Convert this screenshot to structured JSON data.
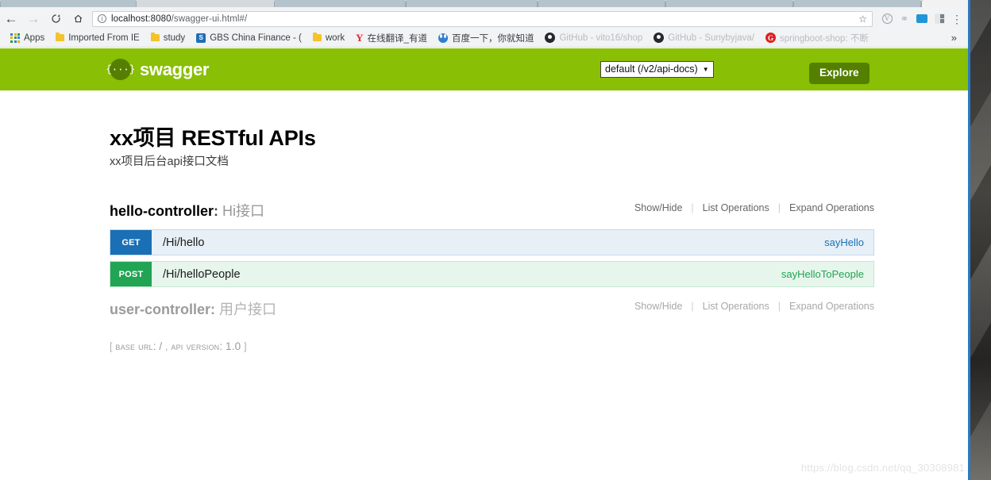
{
  "browser": {
    "nav": {
      "back_icon": "arrow-left-icon",
      "forward_icon": "arrow-right-icon",
      "reload_icon": "reload-icon",
      "home_icon": "home-icon"
    },
    "omnibox": {
      "info_glyph": "i",
      "url_host": "localhost:8080",
      "url_path": "/swagger-ui.html#/",
      "star_glyph": "☆"
    },
    "extensions": [
      {
        "name": "vimium-extension-icon",
        "glyph": "V"
      },
      {
        "name": "shield-extension-icon",
        "glyph": "⛉"
      },
      {
        "name": "chat-extension-icon",
        "glyph": ""
      },
      {
        "name": "window-split-extension-icon",
        "glyph": ""
      }
    ],
    "menu_glyph": "⋮",
    "bookmarks": [
      {
        "label": "Apps",
        "icon": "apps-grid-icon"
      },
      {
        "label": "Imported From IE",
        "icon": "folder-icon"
      },
      {
        "label": "study",
        "icon": "folder-icon"
      },
      {
        "label": "GBS China Finance - (",
        "icon": "sharepoint-icon"
      },
      {
        "label": "work",
        "icon": "folder-icon"
      },
      {
        "label": "在线翻译_有道",
        "icon": "youdao-icon"
      },
      {
        "label": "百度一下，你就知道",
        "icon": "baidu-icon"
      },
      {
        "label": "GitHub - vito16/shop",
        "icon": "github-icon"
      },
      {
        "label": "GitHub - Sunybyjava/",
        "icon": "github-icon"
      },
      {
        "label": "springboot-shop: 不断",
        "icon": "gitee-icon"
      }
    ],
    "overflow_glyph": "»"
  },
  "swagger_header": {
    "logo_glyph": "{···}",
    "logo_text": "swagger",
    "spec_selector_value": "default (/v2/api-docs)",
    "spec_selector_caret": "▼",
    "explore_label": "Explore",
    "bar_color": "#89bf04",
    "accent_color": "#547f00"
  },
  "page": {
    "title": "xx项目 RESTful APIs",
    "subtitle": "xx项目后台api接口文档",
    "base_url_prefix": "[",
    "base_url_label": "BASE URL:",
    "base_url_value": "/",
    "base_url_comma": ",",
    "api_version_label": "API VERSION:",
    "api_version_value": "1.0",
    "base_url_suffix": "]",
    "watermark": "https://blog.csdn.net/qq_30308981"
  },
  "resource_options": {
    "show_hide": "Show/Hide",
    "list_operations": "List Operations",
    "expand_operations": "Expand Operations",
    "separator": "|"
  },
  "resources": [
    {
      "name": "hello-controller",
      "colon": ":",
      "description": "Hi接口",
      "muted": false,
      "operations": [
        {
          "method": "GET",
          "path": "/Hi/hello",
          "nickname": "sayHello",
          "color": "#1a6fb5",
          "row_bg": "#e7f0f7"
        },
        {
          "method": "POST",
          "path": "/Hi/helloPeople",
          "nickname": "sayHelloToPeople",
          "color": "#21a453",
          "row_bg": "#e7f6ec"
        }
      ]
    },
    {
      "name": "user-controller",
      "colon": ":",
      "description": "用户接口",
      "muted": true,
      "operations": []
    }
  ]
}
